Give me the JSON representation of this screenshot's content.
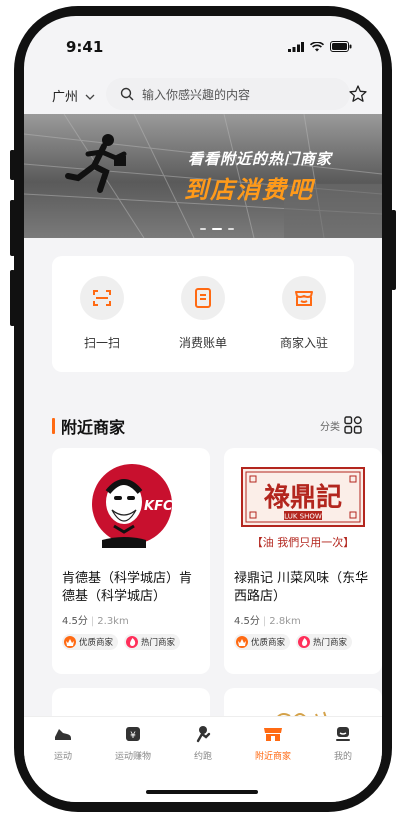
{
  "status": {
    "time": "9:41"
  },
  "header": {
    "city": "广州",
    "search_placeholder": "输入你感兴趣的内容"
  },
  "banner": {
    "line1": "看看附近的热门商家",
    "line2": "到店消费吧"
  },
  "actions": [
    {
      "label": "扫一扫",
      "icon": "scan-icon"
    },
    {
      "label": "消费账单",
      "icon": "bill-icon"
    },
    {
      "label": "商家入驻",
      "icon": "store-icon"
    }
  ],
  "section": {
    "title": "附近商家",
    "category_label": "分类"
  },
  "merchants": [
    {
      "name": "肯德基（科学城店）肯德基（科学城店）",
      "rating": "4.5分",
      "distance": "2.3km",
      "logo_text": "KFC",
      "tags": [
        "优质商家",
        "热门商家"
      ]
    },
    {
      "name": "禄鼎记 川菜风味（东华西路店）",
      "rating": "4.5分",
      "distance": "2.8km",
      "logo_text": "祿鼎記",
      "logo_subtext": "LUK SHOW",
      "logo_slogan": "【油 我們只用一次】",
      "tags": [
        "优质商家",
        "热门商家"
      ]
    }
  ],
  "tabbar": [
    {
      "label": "运动",
      "icon": "shoe-icon",
      "active": false
    },
    {
      "label": "运动赚物",
      "icon": "coupon-icon",
      "active": false
    },
    {
      "label": "约跑",
      "icon": "run-icon",
      "active": false
    },
    {
      "label": "附近商家",
      "icon": "shop-icon",
      "active": true
    },
    {
      "label": "我的",
      "icon": "profile-icon",
      "active": false
    }
  ],
  "colors": {
    "accent": "#ff6a13",
    "banner_orange": "#ff9a1a",
    "kfc_red": "#c8102e",
    "luk_red": "#b3261e"
  }
}
